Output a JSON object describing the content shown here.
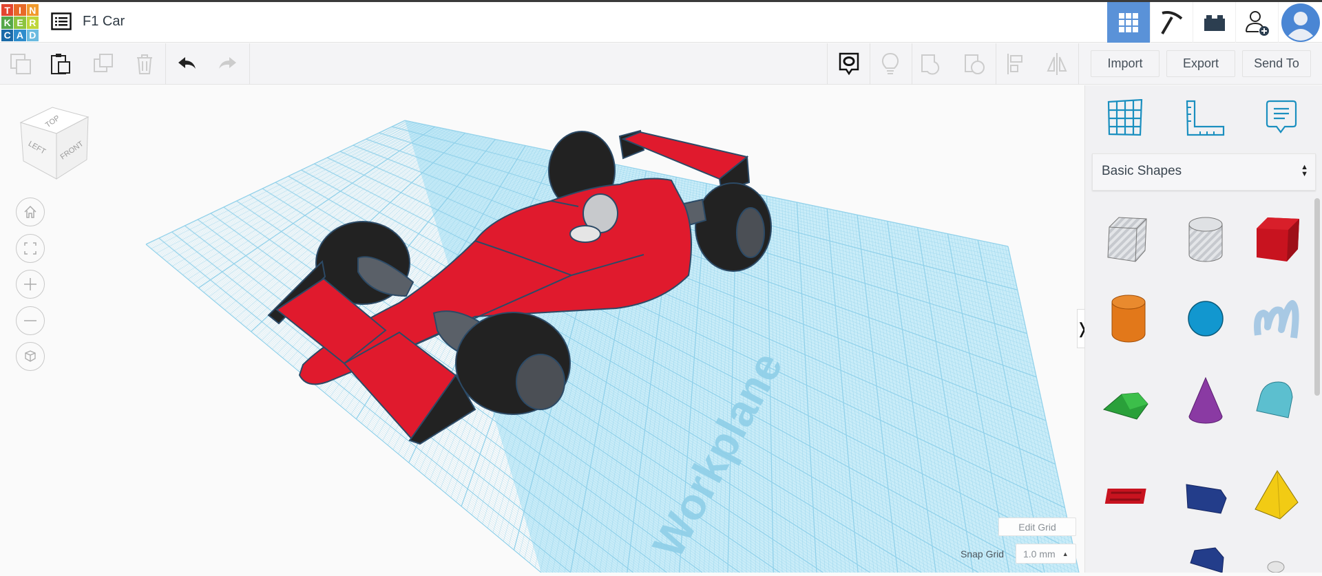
{
  "app": {
    "logo_letters": [
      "T",
      "I",
      "N",
      "K",
      "E",
      "R",
      "C",
      "A",
      "D"
    ],
    "logo_colors": [
      "#e2452f",
      "#e86a27",
      "#f19a2c",
      "#55a74a",
      "#8cc43f",
      "#bfd63b",
      "#1b6aa8",
      "#2e8ccc",
      "#6bbbe0"
    ]
  },
  "header": {
    "title": "F1 Car",
    "accent": "#5a92d8",
    "right_icons": [
      "3d-design-icon",
      "codeblocks-pickaxe-icon",
      "lego-brick-icon",
      "add-user-icon",
      "avatar-icon"
    ]
  },
  "toolbar": {
    "left_icons": [
      "copy-icon",
      "paste-icon",
      "duplicate-icon",
      "delete-icon",
      "undo-icon",
      "redo-icon"
    ],
    "right_icons": [
      "show-notes-icon",
      "lightbulb-icon",
      "shape-group-icon",
      "shape-ungroup-icon",
      "align-icon",
      "mirror-icon"
    ],
    "import_label": "Import",
    "export_label": "Export",
    "sendto_label": "Send To"
  },
  "viewcube": {
    "top": "TOP",
    "left": "LEFT",
    "front": "FRONT"
  },
  "nav": [
    "home-icon",
    "fit-view-icon",
    "zoom-in-icon",
    "zoom-out-icon",
    "ortho-view-icon"
  ],
  "workplane": {
    "label": "Workplane",
    "grid_color": "#8fd0ea",
    "plane_color": "#c9ecf8"
  },
  "panel": {
    "top_icons": [
      "workplane-icon",
      "ruler-icon",
      "notes-icon"
    ],
    "category": "Basic Shapes",
    "shapes": [
      "box-hole",
      "cylinder-hole",
      "box",
      "cylinder",
      "sphere",
      "scribble",
      "roof",
      "cone",
      "round-roof",
      "text",
      "wedge",
      "pyramid",
      "partial-1",
      "polygon",
      "partial-3"
    ]
  },
  "grid": {
    "edit_label": "Edit Grid",
    "snap_label": "Snap Grid",
    "snap_value": "1.0 mm"
  }
}
